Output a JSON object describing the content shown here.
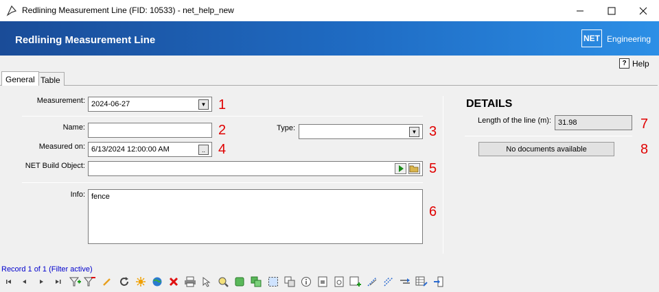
{
  "window": {
    "title": "Redlining Measurement Line (FID: 10533) - net_help_new",
    "minimize_icon": "minimize-icon",
    "maximize_icon": "maximize-icon",
    "close_icon": "close-icon"
  },
  "banner": {
    "title": "Redlining Measurement Line",
    "logo_mark": "NET",
    "logo_text": "Engineering",
    "colors": {
      "start": "#1a4c98",
      "end": "#2c8fe6"
    }
  },
  "help": {
    "icon": "?",
    "label": "Help"
  },
  "tabs": [
    {
      "label": "General",
      "active": true
    },
    {
      "label": "Table",
      "active": false
    }
  ],
  "form": {
    "measurement": {
      "label": "Measurement:",
      "value": "2024-06-27",
      "marker": "1"
    },
    "name": {
      "label": "Name:",
      "value": "",
      "marker": "2"
    },
    "type": {
      "label": "Type:",
      "value": "",
      "marker": "3"
    },
    "measured_on": {
      "label": "Measured on:",
      "value": "6/13/2024 12:00:00 AM",
      "button": "..",
      "marker": "4"
    },
    "build_object": {
      "label": "NET Build Object:",
      "value": "",
      "marker": "5"
    },
    "info": {
      "label": "Info:",
      "value": "fence",
      "marker": "6"
    }
  },
  "details": {
    "heading": "DETAILS",
    "length": {
      "label": "Length of the line (m):",
      "value": "31.98",
      "marker": "7"
    },
    "documents": {
      "label": "No documents available",
      "marker": "8"
    }
  },
  "status": {
    "text": "Record 1 of 1 (Filter active)"
  },
  "colors": {
    "marker": "#e00000",
    "status": "#0000cc"
  },
  "toolbar": {
    "icons": [
      "first-record-icon",
      "previous-record-icon",
      "next-record-icon",
      "last-record-icon",
      "add-filter-icon",
      "remove-filter-icon",
      "edit-icon",
      "refresh-icon",
      "highlight-icon",
      "web-icon",
      "delete-icon",
      "print-icon",
      "select-icon",
      "zoom-icon",
      "copy-geometry-icon",
      "duplicate-icon",
      "select-area-icon",
      "layers-icon",
      "info-icon",
      "report-icon",
      "document-icon",
      "add-record-icon",
      "line-tool-icon",
      "measure-icon",
      "split-icon",
      "table-edit-icon",
      "exit-icon"
    ]
  }
}
